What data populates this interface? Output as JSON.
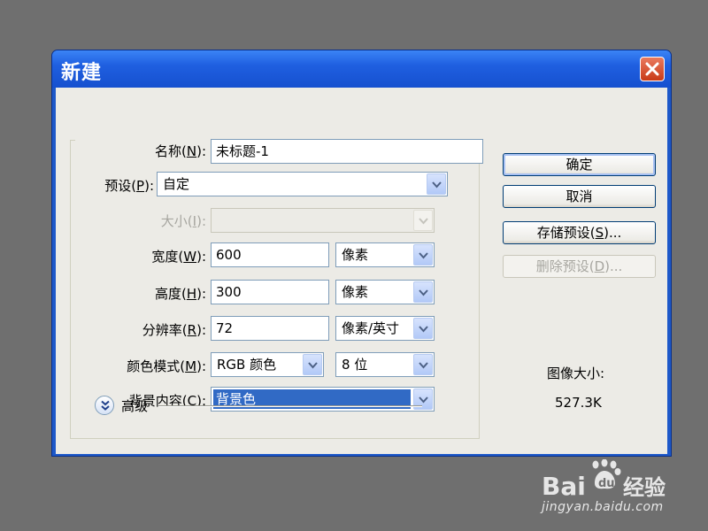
{
  "dialog": {
    "title": "新建"
  },
  "fields": {
    "name": {
      "label_pre": "名称(",
      "key": "N",
      "label_post": "):",
      "value": "未标题-1"
    },
    "preset": {
      "label_pre": "预设(",
      "key": "P",
      "label_post": "):",
      "value": "自定"
    },
    "size": {
      "label_pre": "大小(",
      "key": "I",
      "label_post": "):",
      "value": ""
    },
    "width": {
      "label_pre": "宽度(",
      "key": "W",
      "label_post": "):",
      "value": "600",
      "unit": "像素"
    },
    "height": {
      "label_pre": "高度(",
      "key": "H",
      "label_post": "):",
      "value": "300",
      "unit": "像素"
    },
    "resolution": {
      "label_pre": "分辨率(",
      "key": "R",
      "label_post": "):",
      "value": "72",
      "unit": "像素/英寸"
    },
    "color_mode": {
      "label_pre": "颜色模式(",
      "key": "M",
      "label_post": "):",
      "value": "RGB 颜色",
      "depth": "8 位"
    },
    "background": {
      "label_pre": "背景内容(",
      "key": "C",
      "label_post": "):",
      "value": "背景色"
    }
  },
  "advanced": {
    "label": "高级"
  },
  "buttons": {
    "ok": "确定",
    "cancel": "取消",
    "save_pre": "存储预设(",
    "save_key": "S",
    "save_post": ")...",
    "delete_pre": "删除预设(",
    "delete_key": "D",
    "delete_post": ")..."
  },
  "image_size": {
    "label": "图像大小:",
    "value": "527.3K"
  },
  "watermark": {
    "brand": "Baidu经验",
    "url": "jingyan.baidu.com"
  },
  "colors": {
    "titlebar": "#1f5fe0",
    "client": "#ecebe6",
    "close": "#c83a17",
    "selection": "#316ac5"
  }
}
